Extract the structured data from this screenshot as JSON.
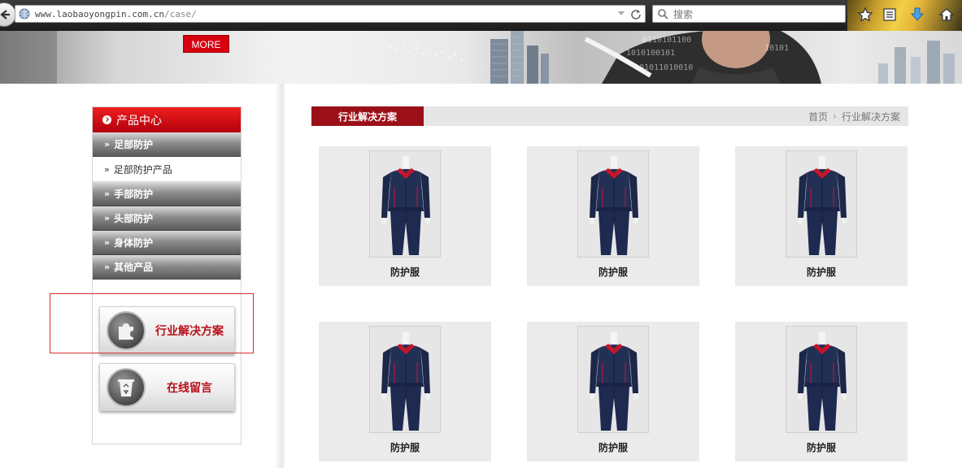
{
  "browser": {
    "url_host": "www.laobaoyongpin.com.cn",
    "url_path": "/case/",
    "search_placeholder": "搜索"
  },
  "banner": {
    "more_label": "MORE"
  },
  "sidebar": {
    "header": "产品中心",
    "items": [
      {
        "label": "足部防护",
        "type": "category"
      },
      {
        "label": "足部防护产品",
        "type": "sub"
      },
      {
        "label": "手部防护",
        "type": "category"
      },
      {
        "label": "头部防护",
        "type": "category"
      },
      {
        "label": "身体防护",
        "type": "category"
      },
      {
        "label": "其他产品",
        "type": "category"
      }
    ],
    "arrow_glyph": "»",
    "buttons": {
      "solutions": "行业解决方案",
      "message": "在线留言"
    }
  },
  "main": {
    "section_title": "行业解决方案",
    "breadcrumb": {
      "home": "首页",
      "current": "行业解决方案"
    },
    "products": [
      {
        "caption": "防护服"
      },
      {
        "caption": "防护服"
      },
      {
        "caption": "防护服"
      },
      {
        "caption": "防护服"
      },
      {
        "caption": "防护服"
      },
      {
        "caption": "防护服"
      }
    ]
  },
  "colors": {
    "accent_red": "#d6000f",
    "title_tab": "#9b1018",
    "jacket_navy": "#233056",
    "collar_red": "#c4162a"
  }
}
